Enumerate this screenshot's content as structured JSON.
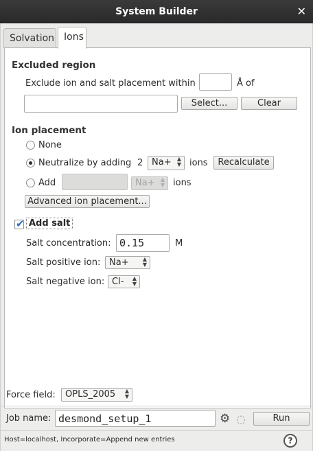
{
  "window": {
    "title": "System Builder"
  },
  "tabs": [
    {
      "label": "Solvation"
    },
    {
      "label": "Ions"
    }
  ],
  "excluded_region": {
    "title": "Excluded region",
    "prefix_label": "Exclude ion and salt placement within",
    "distance_value": "",
    "unit_label": "Å of",
    "selection_value": "",
    "select_button": "Select...",
    "clear_button": "Clear"
  },
  "ion_placement": {
    "title": "Ion placement",
    "none_label": "None",
    "neutralize_label": "Neutralize by adding",
    "neutralize_count": "2",
    "neutralize_ion": "Na+",
    "ions_label": "ions",
    "recalculate_button": "Recalculate",
    "add_label": "Add",
    "add_count": "",
    "add_ion": "Na+",
    "add_ions_label": "ions",
    "advanced_button": "Advanced ion placement...",
    "selected": "neutralize"
  },
  "salt": {
    "checkbox_label": "Add salt",
    "checked": true,
    "concentration_label": "Salt concentration:",
    "concentration_value": "0.15",
    "concentration_unit": "M",
    "positive_label": "Salt positive ion:",
    "positive_value": "Na+",
    "negative_label": "Salt negative ion:",
    "negative_value": "Cl-"
  },
  "force_field": {
    "label": "Force field:",
    "value": "OPLS_2005"
  },
  "job": {
    "label": "Job name:",
    "name_value": "desmond_setup_1",
    "settings_icon": "gear-icon",
    "progress_icon": "spinner-icon",
    "run_button": "Run"
  },
  "status_bar": {
    "text": "Host=localhost, Incorporate=Append new entries",
    "help_symbol": "?"
  },
  "colors": {
    "titlebar": "#2e2e2e",
    "panel": "#ffffff",
    "window": "#ededec",
    "check_accent": "#2a6fc9"
  }
}
